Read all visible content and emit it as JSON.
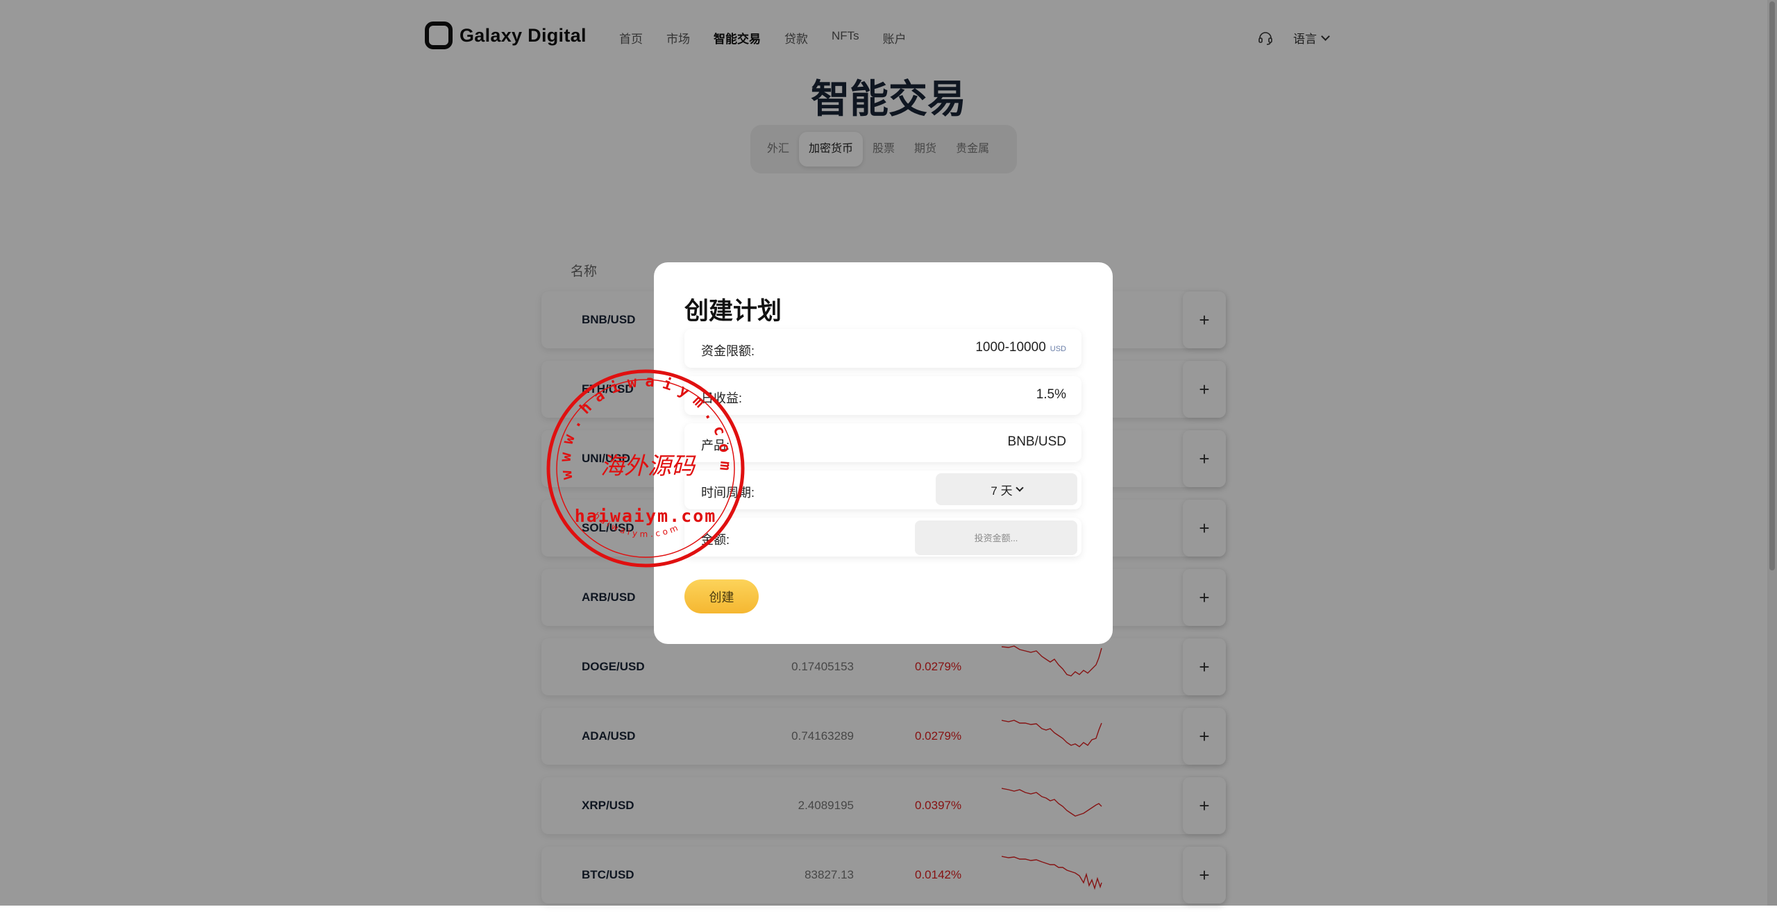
{
  "header": {
    "logo_text": "Galaxy Digital",
    "nav": [
      "首页",
      "市场",
      "智能交易",
      "贷款",
      "NFTs",
      "账户"
    ],
    "nav_active": "智能交易",
    "language_label": "语言"
  },
  "page_title": "智能交易",
  "tabs": [
    "外汇",
    "加密货币",
    "股票",
    "期货",
    "贵金属"
  ],
  "active_tab": "加密货币",
  "table": {
    "name_header": "名称",
    "rows": [
      {
        "name": "BNB/USD",
        "price": "",
        "change": ""
      },
      {
        "name": "ETH/USD",
        "price": "",
        "change": ""
      },
      {
        "name": "UNI/USD",
        "price": "",
        "change": ""
      },
      {
        "name": "SOL/USD",
        "price": "",
        "change": ""
      },
      {
        "name": "ARB/USD",
        "price": "",
        "change": ""
      },
      {
        "name": "DOGE/USD",
        "price": "0.17405153",
        "change": "0.0279%"
      },
      {
        "name": "ADA/USD",
        "price": "0.74163289",
        "change": "0.0279%"
      },
      {
        "name": "XRP/USD",
        "price": "2.4089195",
        "change": "0.0397%"
      },
      {
        "name": "BTC/USD",
        "price": "83827.13",
        "change": "0.0142%"
      }
    ],
    "add_label": "+"
  },
  "modal": {
    "title": "创建计划",
    "fields": {
      "fund_limit": {
        "label": "资金限额:",
        "value": "1000-10000",
        "unit": "USD"
      },
      "daily_return": {
        "label": "日收益:",
        "value": "1.5%"
      },
      "product": {
        "label": "产品:",
        "value": "BNB/USD"
      },
      "period": {
        "label": "时间周期:",
        "value": "7 天"
      },
      "amount": {
        "label": "金额:",
        "placeholder": "投资金额..."
      }
    },
    "create_label": "创建"
  },
  "watermark": {
    "ring_text": "www.haiwaiym.com",
    "center_text": "海外源码",
    "domain_text": "haiwaiym.com",
    "small_text": "haiwaiym.com",
    "color": "#e01010"
  },
  "colors": {
    "negative": "#e02020",
    "button": "#f5b731"
  }
}
